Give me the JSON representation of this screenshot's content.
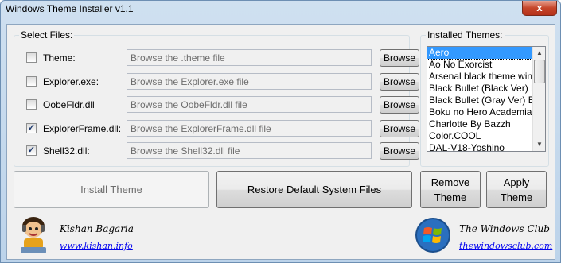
{
  "window": {
    "title": "Windows Theme Installer v1.1",
    "close_label": "x"
  },
  "select_files": {
    "title": "Select Files:",
    "rows": [
      {
        "label": "Theme:",
        "placeholder": "Browse the .theme file",
        "checked": false,
        "browse": "Browse"
      },
      {
        "label": "Explorer.exe:",
        "placeholder": "Browse the Explorer.exe file",
        "checked": false,
        "browse": "Browse"
      },
      {
        "label": "OobeFldr.dll",
        "placeholder": "Browse the OobeFldr.dll file",
        "checked": false,
        "browse": "Browse"
      },
      {
        "label": "ExplorerFrame.dll:",
        "placeholder": "Browse the ExplorerFrame.dll file",
        "checked": true,
        "browse": "Browse"
      },
      {
        "label": "Shell32.dll:",
        "placeholder": "Browse the Shell32.dll file",
        "checked": true,
        "browse": "Browse"
      }
    ]
  },
  "installed_themes": {
    "title": "Installed Themes:",
    "items": [
      "Aero",
      "Ao No Exorcist",
      "Arsenal black theme win",
      "Black Bullet (Black Ver) B",
      "Black Bullet (Gray Ver) B",
      "Boku no Hero Academia",
      "Charlotte By Bazzh",
      "Color.COOL",
      "DAL-V18-Yoshino"
    ],
    "selected": "Aero"
  },
  "buttons": {
    "install": "Install Theme",
    "restore": "Restore Default System Files",
    "remove": "Remove\nTheme",
    "apply": "Apply\nTheme"
  },
  "footer": {
    "author_name": "Kishan Bagaria",
    "author_link": "www.kishan.info",
    "club_name": "The Windows Club",
    "club_link": "thewindowsclub.com"
  },
  "icons": {
    "close": "close-icon",
    "checkbox_checked": "check-icon",
    "scroll_up": "chevron-up-icon",
    "scroll_down": "chevron-down-icon",
    "author": "cartoon-avatar-icon",
    "club": "windows-logo-icon"
  }
}
